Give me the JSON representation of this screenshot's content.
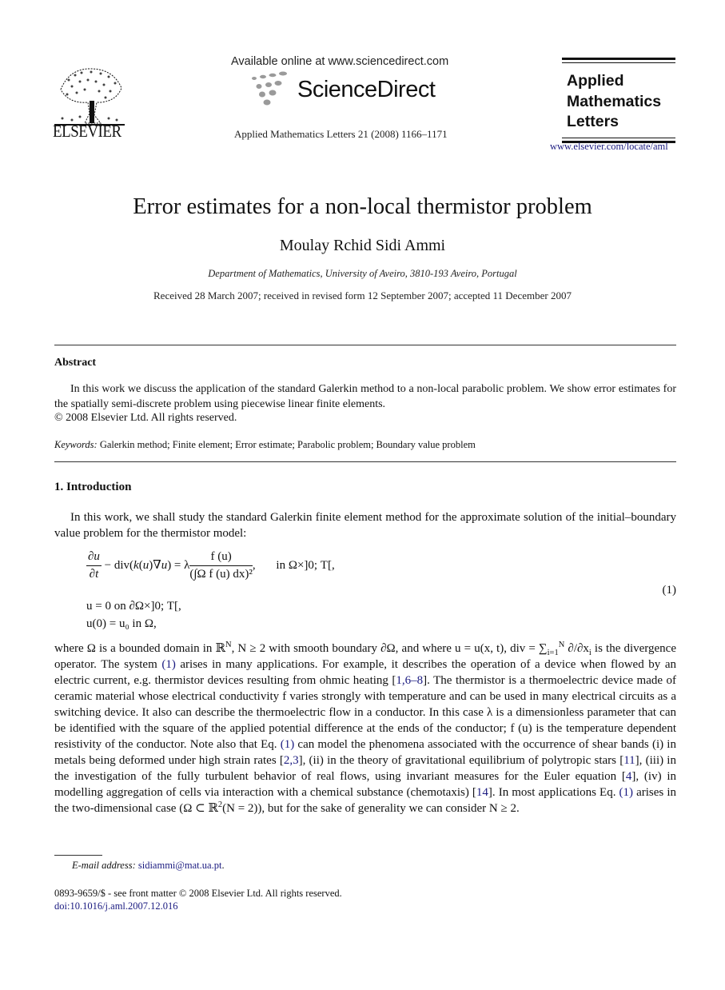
{
  "header": {
    "publisher_wordmark": "ELSEVIER",
    "available_online": "Available online at www.sciencedirect.com",
    "platform_wordmark": "ScienceDirect",
    "journal_citation": "Applied Mathematics Letters 21 (2008) 1166–1171",
    "journal_title_lines": [
      "Applied",
      "Mathematics",
      "Letters"
    ],
    "journal_url": "www.elsevier.com/locate/aml",
    "colors": {
      "link": "#1a1a80",
      "sd_dots": "#9a9a9a"
    }
  },
  "article": {
    "title": "Error estimates for a non-local thermistor problem",
    "author": "Moulay Rchid Sidi Ammi",
    "affiliation": "Department of Mathematics, University of Aveiro, 3810-193 Aveiro, Portugal",
    "dates": "Received 28 March 2007; received in revised form 12 September 2007; accepted 11 December 2007"
  },
  "abstract": {
    "heading": "Abstract",
    "body": "In this work we discuss the application of the standard Galerkin method to a non-local parabolic problem. We show error estimates for the spatially semi-discrete problem using piecewise linear finite elements.",
    "copyright": "© 2008 Elsevier Ltd. All rights reserved.",
    "keywords_label": "Keywords:",
    "keywords": "Galerkin method; Finite element; Error estimate; Parabolic problem; Boundary value problem"
  },
  "introduction": {
    "heading": "1.  Introduction",
    "p1": "In this work, we shall study the standard Galerkin finite element method for the approximate solution of the initial–boundary value problem for the thermistor model:",
    "equation": {
      "line1_lhs": "∂u/∂t − div(k(u)∇u) = λ",
      "line1_num": "f (u)",
      "line1_den": "(∫Ω f (u) dx)²",
      "line1_domain": "in Ω×]0; T[,",
      "line2": "u = 0    on ∂Ω×]0; T[,",
      "line3": "u(0) = u₀    in Ω,",
      "number": "(1)"
    },
    "p2_segments": [
      {
        "t": "where Ω is a bounded domain in ℝ",
        "sup": "N"
      },
      {
        "t": ", N ≥ 2 with smooth boundary ∂Ω, and where u = u(x, t), div = ∑",
        "sub": "i=1",
        "sup2": "N",
        "after": " ∂/∂x"
      },
      {
        "t": " is the divergence operator. The system "
      }
    ],
    "p2_text": {
      "a": "where Ω is a bounded domain in ℝ",
      "a_sup": "N",
      "b": ", N ≥ 2 with smooth boundary ∂Ω, and where u = u(x, t), div = ∑",
      "b_sub": "i=1",
      "b_sup": "N",
      "c": " ∂/∂x",
      "c_sub": "i",
      "d": " is the divergence operator. The system ",
      "ref1": "(1)",
      "e": " arises in many applications. For example, it describes the operation of a device when flowed by an electric current, e.g. thermistor devices resulting from ohmic heating [",
      "ref2": "1,6–8",
      "f": "]. The thermistor is a thermoelectric device made of ceramic material whose electrical conductivity f varies strongly with temperature and can be used in many electrical circuits as a switching device. It also can describe the thermoelectric flow in a conductor. In this case λ is a dimensionless parameter that can be identified with the square of the applied potential difference at the ends of the conductor; f (u) is the temperature dependent resistivity of the conductor. Note also that Eq. ",
      "ref3": "(1)",
      "g": " can model the phenomena associated with the occurrence of shear bands (i) in metals being deformed under high strain rates [",
      "ref4": "2,3",
      "h": "], (ii) in the theory of gravitational equilibrium of polytropic stars [",
      "ref5": "11",
      "i": "], (iii) in the investigation of the fully turbulent behavior of real flows, using invariant measures for the Euler equation [",
      "ref6": "4",
      "j": "], (iv) in modelling aggregation of cells via interaction with a chemical substance (chemotaxis) [",
      "ref7": "14",
      "k": "]. In most applications Eq. ",
      "ref8": "(1)",
      "l": " arises in the two-dimensional case (Ω ⊂ ℝ",
      "l_sup": "2",
      "m": "(N = 2)), but for the sake of generality we can consider N ≥ 2."
    }
  },
  "footer": {
    "email_label": "E-mail address:",
    "email": "sidiammi@mat.ua.pt",
    "email_after": ".",
    "front_matter": "0893-9659/$ - see front matter © 2008 Elsevier Ltd. All rights reserved.",
    "doi": "doi:10.1016/j.aml.2007.12.016"
  }
}
